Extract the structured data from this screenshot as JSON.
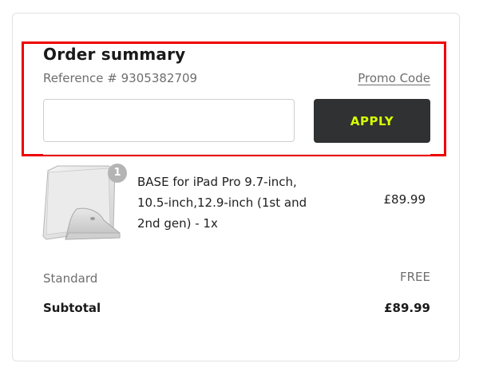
{
  "order_summary": {
    "title": "Order summary",
    "reference": "Reference # 9305382709",
    "promo_link": "Promo Code",
    "promo_input": {
      "value": "",
      "placeholder": ""
    },
    "apply_label": "APPLY"
  },
  "items": [
    {
      "name": "BASE for iPad Pro 9.7-inch, 10.5-inch,12.9-inch (1st and 2nd gen) - 1x",
      "quantity": "1",
      "price": "£89.99",
      "image_icon": "ipad-stand-image"
    }
  ],
  "totals": {
    "shipping_label": "Standard",
    "shipping_value": "FREE",
    "subtotal_label": "Subtotal",
    "subtotal_value": "£89.99"
  },
  "colors": {
    "highlight": "#ee0000",
    "button_bg": "#2f3132",
    "button_text": "#d7ff00"
  }
}
